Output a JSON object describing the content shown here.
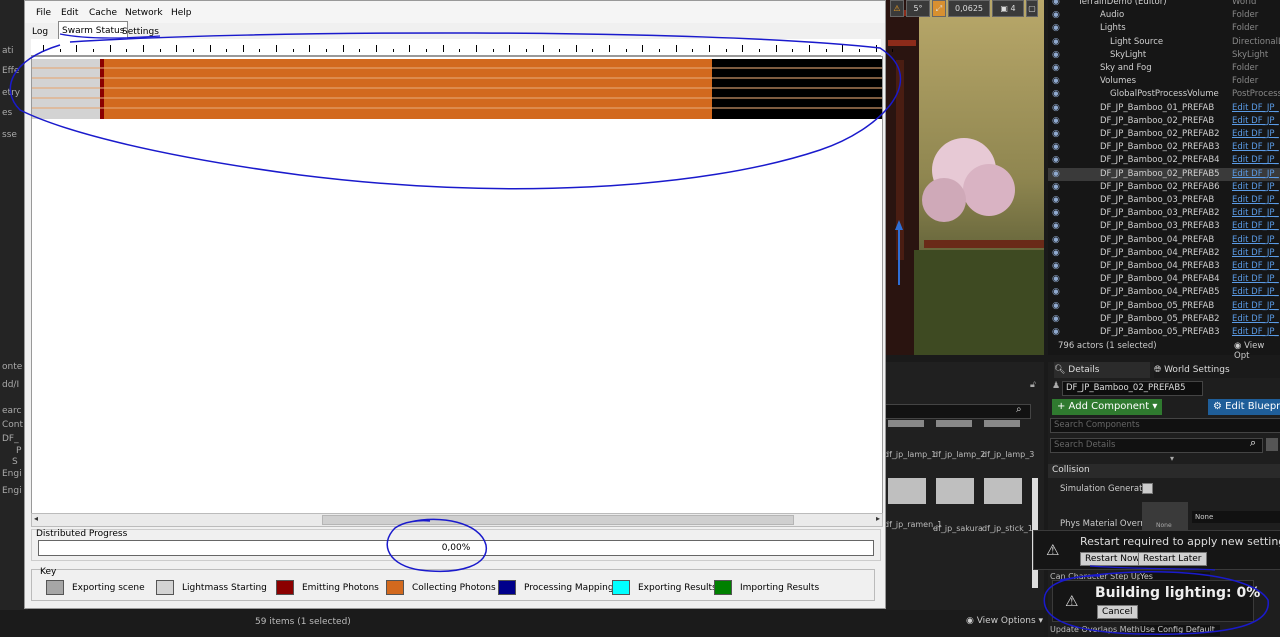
{
  "editor_left": {
    "labels": [
      "ati",
      "Effe",
      "etry",
      "es",
      "sse",
      "onte",
      "dd/I",
      "earc",
      "Cont",
      "DF_",
      "P",
      "S",
      "Engi",
      "Engi"
    ]
  },
  "swarm": {
    "menu": [
      "File",
      "Edit",
      "Cache",
      "Network",
      "Help"
    ],
    "tabs": [
      "Log",
      "Swarm Status",
      "Settings"
    ],
    "active_tab": "Swarm Status",
    "timeline_progress": {
      "lightmass_starting": 0.08,
      "emitting_photons": 0.005,
      "collecting_photons": 0.715,
      "remaining": 0.2
    },
    "distributed_progress": {
      "title": "Distributed Progress",
      "value": "0,00%"
    },
    "key": {
      "title": "Key",
      "items": [
        {
          "label": "Exporting scene",
          "color": "#a6a6a6"
        },
        {
          "label": "Lightmass Starting",
          "color": "#d3d3d3"
        },
        {
          "label": "Emitting Photons",
          "color": "#8b0000"
        },
        {
          "label": "Collecting Photons",
          "color": "#d2691e"
        },
        {
          "label": "Processing Mappings",
          "color": "#00008b"
        },
        {
          "label": "Exporting Results",
          "color": "#00ffff"
        },
        {
          "label": "Importing Results",
          "color": "#008000"
        }
      ]
    }
  },
  "viewport": {
    "toolbar": [
      "5°",
      "0,0625",
      "4"
    ]
  },
  "outliner": {
    "rows": [
      {
        "name": "TerrainDemo (Editor)",
        "type": "World",
        "link": false
      },
      {
        "name": "Audio",
        "type": "Folder",
        "link": false
      },
      {
        "name": "Lights",
        "type": "Folder",
        "link": false
      },
      {
        "name": "Light Source",
        "type": "DirectionalLi",
        "link": false
      },
      {
        "name": "SkyLight",
        "type": "SkyLight",
        "link": false
      },
      {
        "name": "Sky and Fog",
        "type": "Folder",
        "link": false
      },
      {
        "name": "Volumes",
        "type": "Folder",
        "link": false
      },
      {
        "name": "GlobalPostProcessVolume",
        "type": "PostProcessV",
        "link": false
      },
      {
        "name": "DF_JP_Bamboo_01_PREFAB",
        "type": "Edit DF_JP_",
        "link": true
      },
      {
        "name": "DF_JP_Bamboo_02_PREFAB",
        "type": "Edit DF_JP_",
        "link": true
      },
      {
        "name": "DF_JP_Bamboo_02_PREFAB2",
        "type": "Edit DF_JP_",
        "link": true
      },
      {
        "name": "DF_JP_Bamboo_02_PREFAB3",
        "type": "Edit DF_JP_",
        "link": true
      },
      {
        "name": "DF_JP_Bamboo_02_PREFAB4",
        "type": "Edit DF_JP_",
        "link": true
      },
      {
        "name": "DF_JP_Bamboo_02_PREFAB5",
        "type": "Edit DF_JP_",
        "link": true
      },
      {
        "name": "DF_JP_Bamboo_02_PREFAB6",
        "type": "Edit DF_JP_",
        "link": true
      },
      {
        "name": "DF_JP_Bamboo_03_PREFAB",
        "type": "Edit DF_JP_",
        "link": true
      },
      {
        "name": "DF_JP_Bamboo_03_PREFAB2",
        "type": "Edit DF_JP_",
        "link": true
      },
      {
        "name": "DF_JP_Bamboo_03_PREFAB3",
        "type": "Edit DF_JP_",
        "link": true
      },
      {
        "name": "DF_JP_Bamboo_04_PREFAB",
        "type": "Edit DF_JP_",
        "link": true
      },
      {
        "name": "DF_JP_Bamboo_04_PREFAB2",
        "type": "Edit DF_JP_",
        "link": true
      },
      {
        "name": "DF_JP_Bamboo_04_PREFAB3",
        "type": "Edit DF_JP_",
        "link": true
      },
      {
        "name": "DF_JP_Bamboo_04_PREFAB4",
        "type": "Edit DF_JP_",
        "link": true
      },
      {
        "name": "DF_JP_Bamboo_04_PREFAB5",
        "type": "Edit DF_JP_",
        "link": true
      },
      {
        "name": "DF_JP_Bamboo_05_PREFAB",
        "type": "Edit DF_JP_",
        "link": true
      },
      {
        "name": "DF_JP_Bamboo_05_PREFAB2",
        "type": "Edit DF_JP_",
        "link": true
      },
      {
        "name": "DF_JP_Bamboo_05_PREFAB3",
        "type": "Edit DF_JP_",
        "link": true
      }
    ],
    "selected_index": 13,
    "footer": "796 actors (1 selected)",
    "view_options": "View Opt"
  },
  "details": {
    "tab_details": "Details",
    "tab_world": "World Settings",
    "actor_name": "DF_JP_Bamboo_02_PREFAB5",
    "add_component": "+ Add Component ▾",
    "edit_blueprint": "Edit Bluepr",
    "search_components": "Search Components",
    "search_details": "Search Details",
    "section_collision": "Collision",
    "simulation_generates": "Simulation Generates",
    "phys_material": "Phys Material Overrid",
    "none": "None",
    "can_character_step": "Can Character Step Up",
    "yes": "Yes",
    "update_overlaps": "Update Overlaps Meth",
    "use_config_default": "Use Config Default"
  },
  "content_browser": {
    "items_row1": [
      "df_jp_lamp_1",
      "df_jp_lamp_2",
      "df_jp_lamp_3"
    ],
    "items_row2": [
      "df_jp_ramen_1",
      "df_jp_sakura",
      "df_jp_stick_1"
    ],
    "status": "59 items (1 selected)",
    "view_options": "View Options"
  },
  "notifications": {
    "restart": {
      "message": "Restart required to apply new settings",
      "restart_now": "Restart Now",
      "restart_later": "Restart Later"
    },
    "building": {
      "message": "Building lighting:  0%",
      "cancel": "Cancel"
    }
  }
}
